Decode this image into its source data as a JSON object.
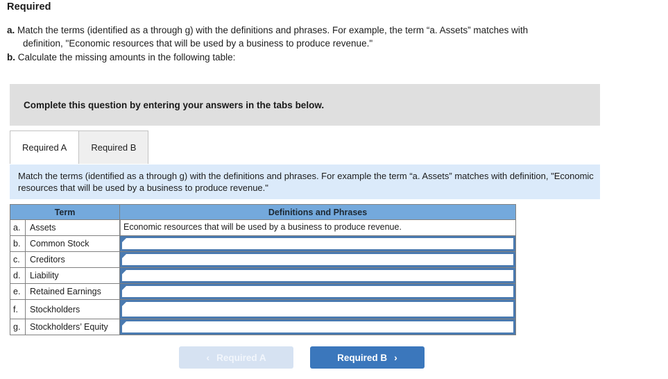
{
  "page_title": "Required",
  "requirements": [
    {
      "marker": "a.",
      "text": "Match the terms (identified as a through g) with the definitions and phrases. For example, the term “a. Assets” matches with",
      "continuation": "definition, \"Economic resources that will be used by a business to produce revenue.\""
    },
    {
      "marker": "b.",
      "text": "Calculate the missing amounts in the following table:",
      "continuation": ""
    }
  ],
  "gray_banner": {
    "text": "Complete this question by entering your answers in the tabs below."
  },
  "tabs": [
    {
      "label": "Required A",
      "active": true
    },
    {
      "label": "Required B",
      "active": false
    }
  ],
  "blue_strip": {
    "text": "Match the terms (identified as a through g) with the definitions and phrases. For example the term “a. Assets” matches with definition, \"Economic resources that will be used by a business to produce revenue.\""
  },
  "table": {
    "headers": [
      "Term",
      "Definitions and Phrases"
    ],
    "rows": [
      {
        "letter": "a.",
        "term": "Assets",
        "definition": "Economic resources that will be used by a business to produce revenue.",
        "filled": true,
        "tall": false
      },
      {
        "letter": "b.",
        "term": "Common Stock",
        "definition": "",
        "filled": false,
        "tall": false
      },
      {
        "letter": "c.",
        "term": "Creditors",
        "definition": "",
        "filled": false,
        "tall": false
      },
      {
        "letter": "d.",
        "term": "Liability",
        "definition": "",
        "filled": false,
        "tall": false
      },
      {
        "letter": "e.",
        "term": "Retained Earnings",
        "definition": "",
        "filled": false,
        "tall": false
      },
      {
        "letter": "f.",
        "term": "Stockholders",
        "definition": "",
        "filled": false,
        "tall": true
      },
      {
        "letter": "g.",
        "term": "Stockholders’ Equity",
        "definition": "",
        "filled": false,
        "tall": false
      }
    ]
  },
  "nav": {
    "prev_label": "Required A",
    "prev_chevron": "‹",
    "next_label": "Required B",
    "next_chevron": "›"
  },
  "colors": {
    "header_blue": "#74a9dc",
    "strip_blue": "#dbeafa",
    "banner_gray": "#dfdfdf",
    "button_blue": "#3b77bc",
    "button_light": "#d6e2f2",
    "input_border": "#4a7ab0"
  }
}
